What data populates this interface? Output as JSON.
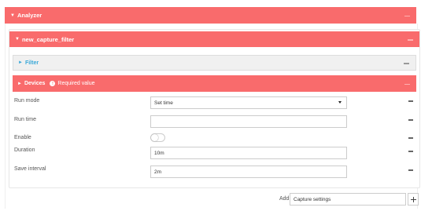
{
  "analyzer": {
    "title": "Analyzer",
    "arrow": "▼"
  },
  "capture": {
    "title": "new_capture_filter",
    "arrow": "▼"
  },
  "filter": {
    "title": "Filter",
    "arrow": "►"
  },
  "devices": {
    "title": "Devices",
    "arrow": "►",
    "required": "Required value",
    "required_icon": "!"
  },
  "rows": {
    "run_mode": {
      "label": "Run mode",
      "value": "Set time"
    },
    "run_time": {
      "label": "Run time",
      "value": ""
    },
    "enable": {
      "label": "Enable",
      "value": false
    },
    "duration": {
      "label": "Duration",
      "value": "10m"
    },
    "save_interval": {
      "label": "Save interval",
      "value": "2m"
    }
  },
  "add": {
    "label": "Add",
    "value": "Capture settings"
  },
  "colors": {
    "accent": "#f96b6c",
    "link": "#3aa8d8"
  },
  "icons": {
    "collapse": "chevron-down-icon",
    "expand": "chevron-right-icon",
    "remove": "minus-icon",
    "add": "plus-icon"
  }
}
